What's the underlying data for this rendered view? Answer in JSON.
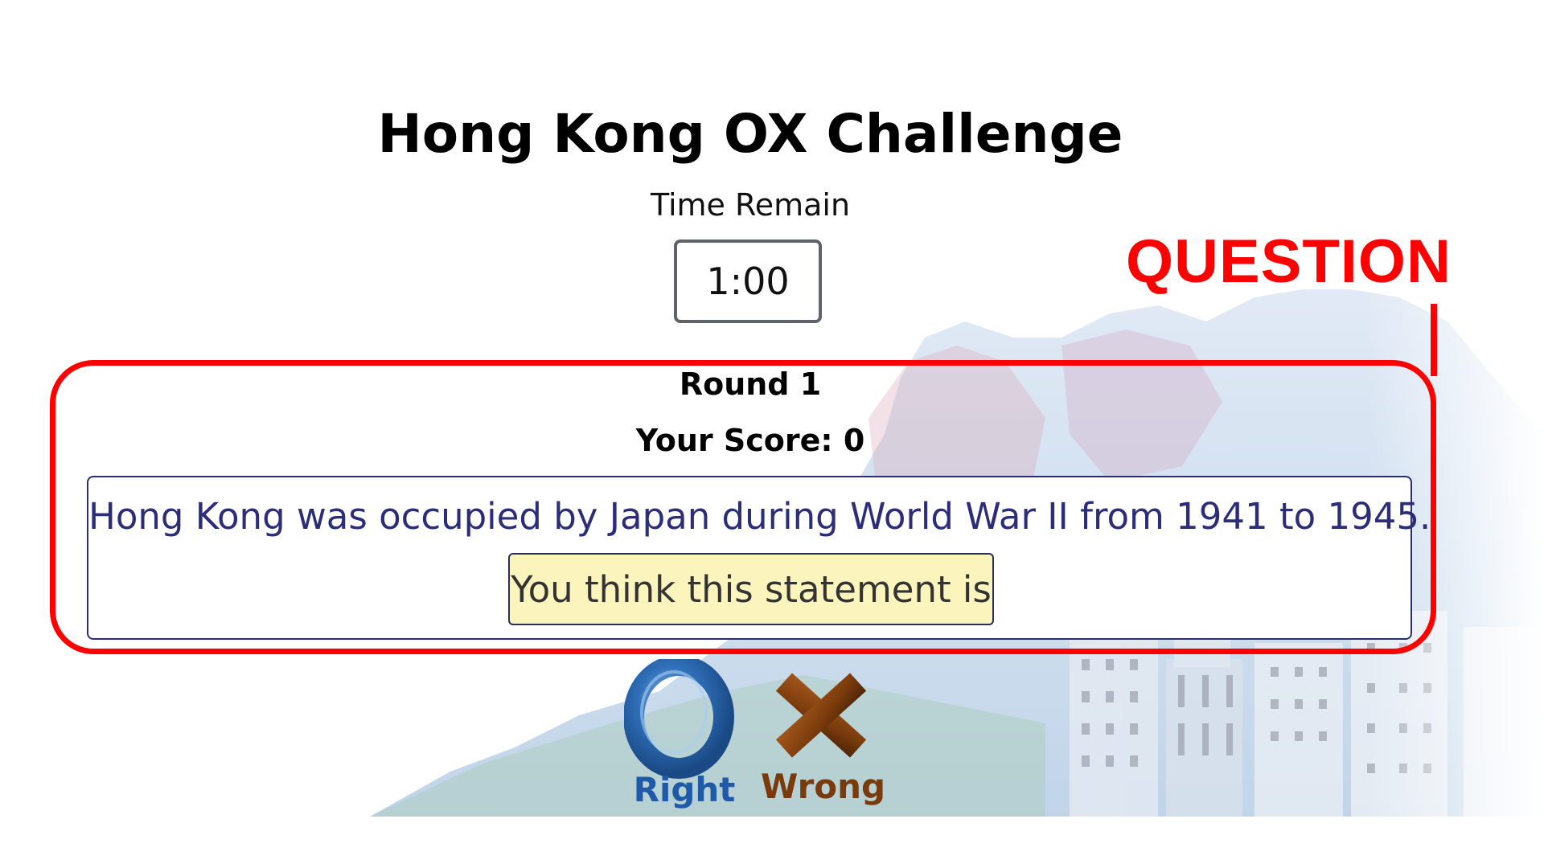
{
  "game": {
    "title": "Hong Kong OX Challenge",
    "time_label": "Time Remain",
    "timer": "1:00",
    "round": "Round 1",
    "score": "Your Score: 0",
    "statement": "Hong Kong was occupied by Japan during World War II from 1941 to 1945.",
    "prompt": "You think this statement is"
  },
  "answers": {
    "right_label": "Right",
    "wrong_label": "Wrong",
    "right_icon": "o-ring-icon",
    "wrong_icon": "x-cross-icon"
  },
  "annotation": {
    "label": "QUESTION",
    "color": "#ff0000"
  },
  "colors": {
    "statement_text": "#2b2d78",
    "prompt_bg": "#fcf4bd",
    "right_blue": "#1f5aa6",
    "wrong_brown": "#7a3b0c"
  }
}
